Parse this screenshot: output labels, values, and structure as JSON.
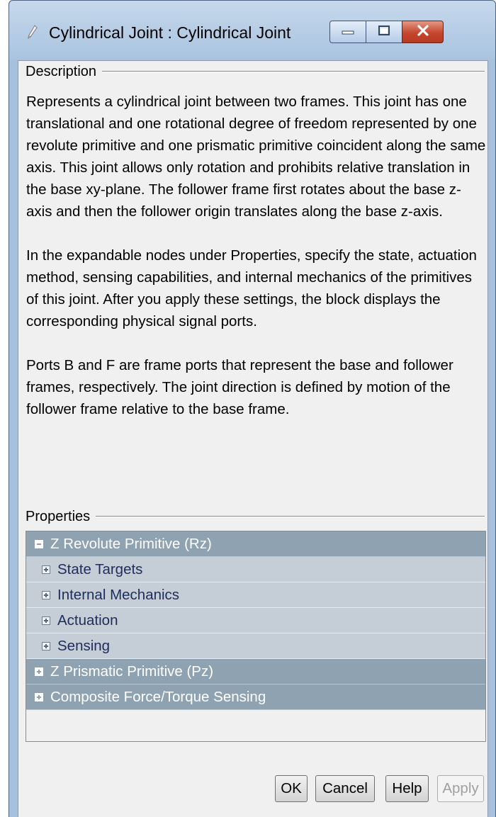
{
  "window": {
    "title": "Cylindrical Joint : Cylindrical Joint",
    "icon": "pencil-icon",
    "controls": [
      "minimize-icon",
      "maximize-icon",
      "close-icon"
    ]
  },
  "description": {
    "header": "Description",
    "paragraphs": [
      "Represents a cylindrical joint between two frames. This joint has one translational and one rotational degree of freedom represented by one revolute primitive and one prismatic primitive coincident along the same axis. This joint allows only rotation and prohibits relative translation in the base xy-plane. The follower frame first rotates about the base z-axis and then the follower origin translates along the base z-axis.",
      "In the expandable nodes under Properties, specify the state, actuation method, sensing capabilities, and internal mechanics of the primitives of this joint. After you apply these settings, the block displays the corresponding physical signal ports.",
      "Ports B and F are frame ports that represent the base and follower frames, respectively. The joint direction is defined by motion of the follower frame relative to the base frame."
    ]
  },
  "properties": {
    "header": "Properties",
    "tree": [
      {
        "label": "Z Revolute Primitive (Rz)",
        "level": 1,
        "expanded": true
      },
      {
        "label": "State Targets",
        "level": 2,
        "expanded": false
      },
      {
        "label": "Internal Mechanics",
        "level": 2,
        "expanded": false
      },
      {
        "label": "Actuation",
        "level": 2,
        "expanded": false
      },
      {
        "label": "Sensing",
        "level": 2,
        "expanded": false
      },
      {
        "label": "Z Prismatic Primitive (Pz)",
        "level": 1,
        "expanded": false
      },
      {
        "label": "Composite Force/Torque Sensing",
        "level": 1,
        "expanded": false
      }
    ]
  },
  "buttons": {
    "ok": "OK",
    "cancel": "Cancel",
    "help": "Help",
    "apply": "Apply"
  },
  "colors": {
    "tree_level1_bg": "#8fa2b2",
    "tree_level2_bg": "#c5ced6",
    "close_button": "#c5452d",
    "frame": "#a7c0dc"
  }
}
